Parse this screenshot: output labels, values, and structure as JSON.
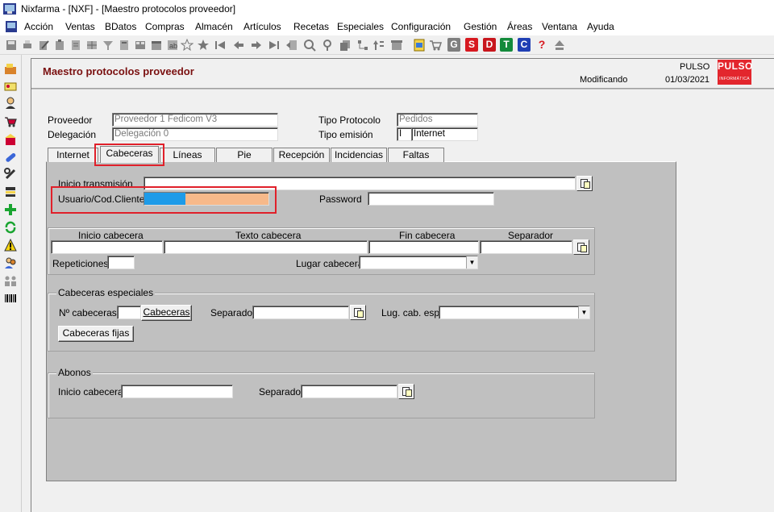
{
  "window": {
    "title": "Nixfarma - [NXF] - [Maestro protocolos proveedor]"
  },
  "menu": [
    "Acción",
    "Ventas",
    "BDatos",
    "Compras",
    "Almacén",
    "Artículos",
    "Recetas",
    "Especiales",
    "Configuración",
    "Gestión",
    "Áreas",
    "Ventana",
    "Ayuda"
  ],
  "toolbar": {
    "letters": [
      "G",
      "S",
      "D",
      "T",
      "C",
      "?"
    ]
  },
  "header": {
    "form_title": "Maestro protocolos proveedor",
    "user": "PULSO",
    "status": "Modificando",
    "date": "01/03/2021",
    "logo_main": "PULSO",
    "logo_sub": "INFORMÁTICA"
  },
  "form": {
    "proveedor_label": "Proveedor",
    "proveedor_value": "Proveedor 1 Fedicom V3",
    "delegacion_label": "Delegación",
    "delegacion_value": "Delegación 0",
    "tipo_protocolo_label": "Tipo Protocolo",
    "tipo_protocolo_value": "Pedidos",
    "tipo_emision_label": "Tipo emisión",
    "tipo_emision_code": "I",
    "tipo_emision_value": "Internet"
  },
  "tabs": [
    "Internet",
    "Cabeceras",
    "Líneas",
    "Pie",
    "Recepción",
    "Incidencias",
    "Faltas"
  ],
  "active_tab": "Cabeceras",
  "cabeceras": {
    "inicio_transmision_label": "Inicio transmisión",
    "usuario_label": "Usuario/Cod.Cliente",
    "password_label": "Password",
    "inicio_cabecera_label": "Inicio cabecera",
    "texto_cabecera_label": "Texto cabecera",
    "fin_cabecera_label": "Fin cabecera",
    "separador_label": "Separador",
    "repeticiones_label": "Repeticiones",
    "lugar_cabecera_label": "Lugar cabecera",
    "especiales": {
      "group_label": "Cabeceras especiales",
      "num_cabeceras_label": "Nº cabeceras",
      "cabeceras_button": "Cabeceras",
      "separador_label": "Separador",
      "lug_cab_esp_label": "Lug. cab. esp.",
      "fijas_button": "Cabeceras fijas"
    },
    "abonos": {
      "group_label": "Abonos",
      "inicio_cabecera_label": "Inicio cabecera",
      "separador_label": "Separador"
    }
  },
  "colors": {
    "title_red": "#7a1010",
    "highlight": "#e0202a",
    "usuario_blue": "#1e9be8",
    "usuario_orange": "#f7b98a"
  }
}
